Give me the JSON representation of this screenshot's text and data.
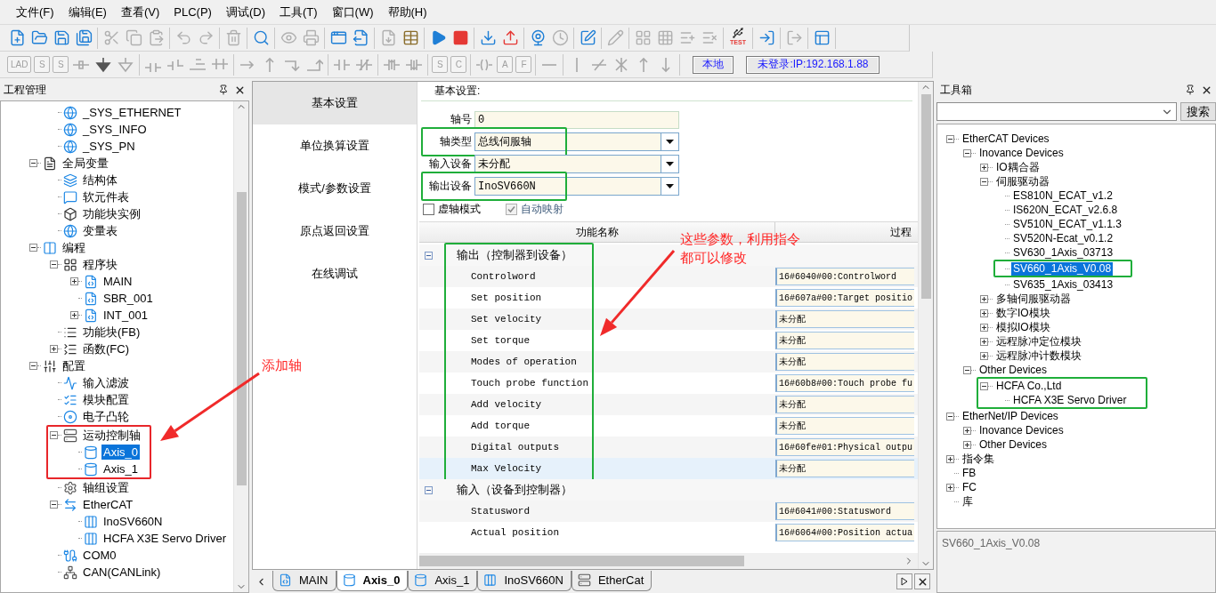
{
  "menu": [
    "文件(F)",
    "编辑(E)",
    "查看(V)",
    "PLC(P)",
    "调试(D)",
    "工具(T)",
    "窗口(W)",
    "帮助(H)"
  ],
  "toolbar_main": [
    [
      {
        "disabled": false
      },
      {
        "disabled": false
      },
      {
        "disabled": false
      },
      {
        "disabled": false
      }
    ],
    [
      {
        "disabled": true
      },
      {
        "disabled": true
      },
      {
        "disabled": true
      }
    ],
    [
      {
        "disabled": true
      },
      {
        "disabled": true
      }
    ],
    [
      {
        "disabled": true
      }
    ],
    [
      {
        "disabled": false
      }
    ],
    [
      {
        "disabled": true
      },
      {
        "disabled": true
      }
    ],
    [
      {
        "disabled": false
      },
      {
        "disabled": false
      }
    ],
    [
      {
        "disabled": true
      },
      {
        "disabled": false
      }
    ],
    [
      {
        "disabled": false
      },
      {
        "disabled": false
      }
    ],
    [
      {
        "disabled": false
      },
      {
        "disabled": false
      }
    ],
    [
      {
        "disabled": false
      },
      {
        "disabled": true
      }
    ],
    [
      {
        "disabled": false
      }
    ],
    [
      {
        "disabled": true
      }
    ],
    [
      {
        "disabled": true
      },
      {
        "disabled": true
      },
      {
        "disabled": true
      },
      {
        "disabled": true
      }
    ],
    [
      {
        "disabled": false,
        "label": "TEST"
      }
    ],
    [
      {
        "disabled": false
      }
    ],
    [
      {
        "disabled": true
      }
    ],
    [
      {
        "disabled": false
      }
    ]
  ],
  "toolbar_ladder": [
    [
      {
        "disabled": true,
        "label": "LAD"
      },
      {
        "disabled": true,
        "label": "S"
      },
      {
        "disabled": true,
        "label": "S"
      },
      {
        "disabled": true
      },
      {
        "disabled": false
      },
      {
        "disabled": true
      }
    ],
    [
      {
        "disabled": true
      },
      {
        "disabled": true
      },
      {
        "disabled": true
      },
      {
        "disabled": true
      }
    ],
    [
      {
        "disabled": true
      },
      {
        "disabled": true
      },
      {
        "disabled": true
      },
      {
        "disabled": true
      }
    ],
    [
      {
        "disabled": true
      },
      {
        "disabled": true
      }
    ],
    [
      {
        "disabled": true
      },
      {
        "disabled": true
      }
    ],
    [
      {
        "disabled": true,
        "label": "S"
      },
      {
        "disabled": true,
        "label": "C"
      }
    ],
    [
      {
        "disabled": true
      },
      {
        "disabled": true,
        "label": "A"
      },
      {
        "disabled": true,
        "label": "F"
      }
    ],
    [
      {
        "disabled": true
      }
    ],
    [
      {
        "disabled": true
      },
      {
        "disabled": true
      },
      {
        "disabled": true
      },
      {
        "disabled": true
      },
      {
        "disabled": true
      }
    ]
  ],
  "connection": {
    "mode": "本地",
    "status": "未登录:IP:192.168.1.88"
  },
  "project": {
    "title": "工程管理",
    "items": [
      {
        "children": [
          {
            "label": "_SYS_ETHERNET",
            "kind": "globe",
            "selected": false
          },
          {
            "label": "_SYS_INFO",
            "kind": "globe",
            "selected": false
          },
          {
            "label": "_SYS_PN",
            "kind": "globe",
            "selected": false
          }
        ]
      },
      {
        "label": "全局变量",
        "kind": "sheet",
        "expanded": true,
        "selected": false,
        "children": [
          {
            "label": "结构体",
            "kind": "struct",
            "selected": false
          },
          {
            "label": "软元件表",
            "kind": "chat",
            "selected": false
          },
          {
            "label": "功能块实例",
            "kind": "cube",
            "selected": false
          },
          {
            "label": "变量表",
            "kind": "globe",
            "selected": false
          }
        ]
      },
      {
        "label": "编程",
        "kind": "ladder",
        "expanded": true,
        "selected": false,
        "children": [
          {
            "label": "程序块",
            "kind": "blocks",
            "expanded": true,
            "selected": false,
            "children": [
              {
                "label": "MAIN",
                "kind": "program",
                "expanded": false,
                "selected": false
              },
              {
                "label": "SBR_001",
                "kind": "program",
                "selected": false
              },
              {
                "label": "INT_001",
                "kind": "program",
                "expanded": false,
                "selected": false
              }
            ]
          },
          {
            "label": "功能块(FB)",
            "kind": "fb",
            "selected": false
          },
          {
            "label": "函数(FC)",
            "kind": "fc",
            "expanded": false,
            "selected": false
          }
        ]
      },
      {
        "label": "配置",
        "kind": "config",
        "expanded": true,
        "selected": false,
        "children": [
          {
            "label": "输入滤波",
            "kind": "wave",
            "selected": false
          },
          {
            "label": "模块配置",
            "kind": "module",
            "selected": false
          },
          {
            "label": "电子凸轮",
            "kind": "cam",
            "selected": false
          },
          {
            "label": "运动控制轴",
            "kind": "axes",
            "expanded": true,
            "boxed": true,
            "selected": false,
            "children": [
              {
                "label": "Axis_0",
                "kind": "axis",
                "selected": true
              },
              {
                "label": "Axis_1",
                "kind": "axis",
                "selected": false
              }
            ]
          },
          {
            "label": "轴组设置",
            "kind": "gear",
            "selected": false
          },
          {
            "label": "EtherCAT",
            "kind": "exchange",
            "expanded": true,
            "selected": false,
            "children": [
              {
                "label": "InoSV660N",
                "kind": "device",
                "selected": false
              },
              {
                "label": "HCFA X3E Servo Driver",
                "kind": "device",
                "selected": false
              }
            ]
          },
          {
            "label": "COM0",
            "kind": "port",
            "selected": false
          },
          {
            "label": "CAN(CANLink)",
            "kind": "can",
            "selected": false
          }
        ]
      }
    ]
  },
  "editor_nav": [
    {
      "label": "基本设置",
      "selected": true
    },
    {
      "label": "单位换算设置",
      "selected": false
    },
    {
      "label": "模式/参数设置",
      "selected": false
    },
    {
      "label": "原点返回设置",
      "selected": false
    },
    {
      "label": "在线调试",
      "selected": false
    }
  ],
  "axis_form": {
    "heading": "基本设置:",
    "fields": [
      {
        "label": "轴号",
        "value": "0",
        "kind": "text",
        "boxed": false
      },
      {
        "label": "轴类型",
        "value": "总线伺服轴",
        "kind": "dropdown",
        "boxed": true
      },
      {
        "label": "输入设备",
        "value": "未分配",
        "kind": "dropdown",
        "boxed": false
      },
      {
        "label": "输出设备",
        "value": "InoSV660N",
        "kind": "dropdown",
        "boxed": true
      }
    ],
    "options": [
      {
        "label": "虚轴模式",
        "checked": false,
        "disabled": false
      },
      {
        "label": "自动映射",
        "checked": true,
        "disabled": true
      }
    ],
    "table": {
      "columns": [
        "功能名称",
        "过程"
      ],
      "groups": [
        {
          "label": "输出（控制器到设备）",
          "expanded": true,
          "boxed": true,
          "rows": [
            {
              "name": "Controlword",
              "value": "16#6040#00:Controlword",
              "selected": false
            },
            {
              "name": "Set position",
              "value": "16#607a#00:Target positio",
              "selected": false
            },
            {
              "name": "Set velocity",
              "value": "未分配",
              "selected": false
            },
            {
              "name": "Set torque",
              "value": "未分配",
              "selected": false
            },
            {
              "name": "Modes of operation",
              "value": "未分配",
              "selected": false
            },
            {
              "name": "Touch probe function",
              "value": "16#60b8#00:Touch probe fu",
              "selected": false
            },
            {
              "name": "Add velocity",
              "value": "未分配",
              "selected": false
            },
            {
              "name": "Add torque",
              "value": "未分配",
              "selected": false
            },
            {
              "name": "Digital outputs",
              "value": "16#60fe#01:Physical outpu",
              "selected": false
            },
            {
              "name": "Max Velocity",
              "value": "未分配",
              "selected": true
            }
          ]
        },
        {
          "label": "输入（设备到控制器）",
          "expanded": true,
          "boxed": false,
          "rows": [
            {
              "name": "Statusword",
              "value": "16#6041#00:Statusword",
              "selected": false
            },
            {
              "name": "Actual position",
              "value": "16#6064#00:Position actua",
              "selected": false
            }
          ]
        }
      ]
    }
  },
  "editor_tabs": [
    {
      "label": "MAIN",
      "kind": "program",
      "selected": false
    },
    {
      "label": "Axis_0",
      "kind": "axis",
      "selected": true
    },
    {
      "label": "Axis_1",
      "kind": "axis",
      "selected": false
    },
    {
      "label": "InoSV660N",
      "kind": "device",
      "selected": false
    },
    {
      "label": "EtherCat",
      "kind": "network",
      "selected": false
    }
  ],
  "toolbox": {
    "title": "工具箱",
    "search_button": "搜索",
    "items": [
      {
        "label": "EtherCAT Devices",
        "expanded": true,
        "selected": false,
        "children": [
          {
            "label": "Inovance Devices",
            "expanded": true,
            "selected": false,
            "children": [
              {
                "label": "IO耦合器",
                "expanded": false,
                "selected": false
              },
              {
                "label": "伺服驱动器",
                "expanded": true,
                "selected": false,
                "children": [
                  {
                    "label": "ES810N_ECAT_v1.2",
                    "selected": false
                  },
                  {
                    "label": "IS620N_ECAT_v2.6.8",
                    "selected": false
                  },
                  {
                    "label": "SV510N_ECAT_v1.1.3",
                    "selected": false
                  },
                  {
                    "label": "SV520N-Ecat_v0.1.2",
                    "selected": false
                  },
                  {
                    "label": "SV630_1Axis_03713",
                    "selected": false
                  },
                  {
                    "label": "SV660_1Axis_V0.08",
                    "selected": true,
                    "boxed": true
                  },
                  {
                    "label": "SV635_1Axis_03413",
                    "selected": false
                  }
                ]
              },
              {
                "label": "多轴伺服驱动器",
                "expanded": false,
                "selected": false
              },
              {
                "label": "数字IO模块",
                "expanded": false,
                "selected": false
              },
              {
                "label": "模拟IO模块",
                "expanded": false,
                "selected": false
              },
              {
                "label": "远程脉冲定位模块",
                "expanded": false,
                "selected": false
              },
              {
                "label": "远程脉冲计数模块",
                "expanded": false,
                "selected": false
              }
            ]
          },
          {
            "label": "Other Devices",
            "expanded": true,
            "selected": false,
            "children": [
              {
                "label": "HCFA Co.,Ltd",
                "expanded": true,
                "boxed": true,
                "selected": false,
                "children": [
                  {
                    "label": "HCFA X3E Servo Driver",
                    "selected": false
                  }
                ]
              }
            ]
          }
        ]
      },
      {
        "label": "EtherNet/IP Devices",
        "expanded": true,
        "selected": false,
        "children": [
          {
            "label": "Inovance Devices",
            "expanded": false,
            "selected": false
          },
          {
            "label": "Other Devices",
            "expanded": false,
            "selected": false
          }
        ]
      },
      {
        "label": "指令集",
        "expanded": false,
        "selected": false
      },
      {
        "label": "FB",
        "selected": false
      },
      {
        "label": "FC",
        "expanded": false,
        "selected": false
      },
      {
        "label": "库",
        "selected": false
      }
    ],
    "description": "SV660_1Axis_V0.08"
  },
  "annotations": [
    {
      "lines": [
        "添加轴"
      ]
    },
    {
      "lines": [
        "这些参数，利用指令",
        "都可以修改"
      ]
    }
  ]
}
